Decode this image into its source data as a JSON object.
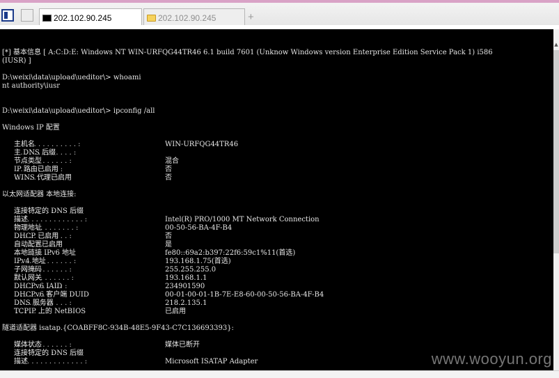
{
  "tabs": {
    "active_title": "202.102.90.245",
    "inactive_title": "202.102.90.245",
    "add_symbol": "+"
  },
  "console": {
    "lines": [
      "[*] 基本信息 [ A:C:D:E: Windows NT WIN-URFQG44TR46 6.1 build 7601 (Unknow Windows version Enterprise Edition Service Pack 1) i586",
      "(IUSR) ]",
      "D:\\weixi\\data\\upload\\ueditor\\> whoami",
      "nt authority\\iusr",
      "D:\\weixi\\data\\upload\\ueditor\\> ipconfig /all",
      "Windows IP 配置",
      "以太网适配器 本地连接:",
      "隧道适配器 isatap.{COABFF8C-934B-48E5-9F43-C7C136693393}:"
    ],
    "windows_ip": [
      {
        "key": "主机名",
        "dots": " . . . . . . . . . . . . . . :",
        "value": "WIN-URFQG44TR46"
      },
      {
        "key": "主 DNS 后缀",
        "dots": " . . . . . . . . . . . . . :",
        "value": ""
      },
      {
        "key": "节点类型",
        "dots": " . . . . . . . . . . . . :",
        "value": "混合"
      },
      {
        "key": "IP 路由已启用",
        "dots": " . . . . . . . . . . :",
        "value": "否"
      },
      {
        "key": "WINS 代理已启用",
        "dots": " . . . . . . . . . :",
        "value": "否"
      }
    ],
    "ethernet": [
      {
        "key": "连接特定的 DNS 后缀",
        "dots": " . . . . . . . . :",
        "value": ""
      },
      {
        "key": "描述",
        "dots": ". . . . . . . . . . . . . . . . :",
        "value": "Intel(R) PRO/1000 MT Network Connection"
      },
      {
        "key": "物理地址",
        "dots": ". . . . . . . . . . . . . . :",
        "value": "00-50-56-BA-4F-B4"
      },
      {
        "key": "DHCP 已启用",
        "dots": " . . . . . . . . . . . . :",
        "value": "否"
      },
      {
        "key": "自动配置已启用",
        "dots": ". . . . . . . . . . :",
        "value": "是"
      },
      {
        "key": "本地链接 IPv6 地址",
        "dots": ". . . . . . . . :",
        "value": "fe80::69a2:b397:22f6:59c1%11(首选)"
      },
      {
        "key": "IPv4 地址",
        "dots": " . . . . . . . . . . . . . :",
        "value": "193.168.1.75(首选)"
      },
      {
        "key": "子网掩码",
        "dots": " . . . . . . . . . . . . :",
        "value": "255.255.255.0"
      },
      {
        "key": "默认网关",
        "dots": ". . . . . . . . . . . . . :",
        "value": "193.168.1.1"
      },
      {
        "key": "DHCPv6 IAID",
        "dots": " . . . . . . . . . . . :",
        "value": "234901590"
      },
      {
        "key": "DHCPv6 客户端 DUID",
        "dots": " . . . . . . . :",
        "value": "00-01-00-01-1B-7E-E8-60-00-50-56-BA-4F-B4"
      },
      {
        "key": "DNS 服务器",
        "dots": " . . . . . . . . . . . . :",
        "value": "218.2.135.1"
      },
      {
        "key": "TCPIP 上的 NetBIOS",
        "dots": " . . . . . . . :",
        "value": "已启用"
      }
    ],
    "isatap": [
      {
        "key": "媒体状态",
        "dots": " . . . . . . . . . . . . :",
        "value": "媒体已断开"
      },
      {
        "key": "连接特定的 DNS 后缀",
        "dots": " . . . . . . . . :",
        "value": ""
      },
      {
        "key": "描述",
        "dots": ". . . . . . . . . . . . . . . . :",
        "value": "Microsoft ISATAP Adapter"
      }
    ]
  },
  "watermark": "www.wooyun.org"
}
